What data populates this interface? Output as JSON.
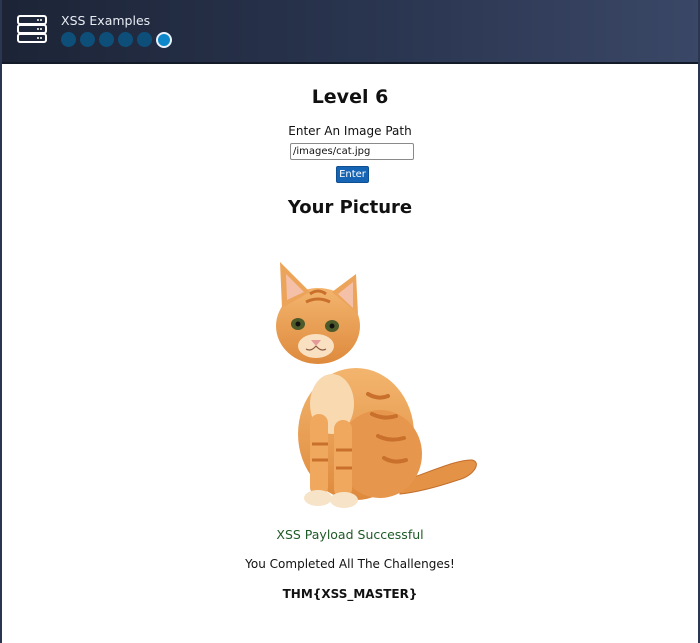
{
  "header": {
    "app_icon": "server-rack-icon",
    "title": "XSS Examples",
    "progress": {
      "total_levels": 6,
      "current_level": 6
    }
  },
  "main": {
    "level_title": "Level 6",
    "path_label": "Enter An Image Path",
    "path_input_value": "/images/cat.jpg",
    "enter_button_label": "Enter",
    "picture_heading": "Your Picture",
    "image_subject": "orange-kitten-image",
    "payload_status": "XSS Payload Successful",
    "completion_message": "You Completed All The Challenges!",
    "flag": "THM{XSS_MASTER}"
  },
  "colors": {
    "header_bg": "#2a3550",
    "progress_dot": "#0e4f7a",
    "progress_dot_current": "#0d87c9",
    "button_bg": "#1565b4",
    "success_text": "#1d5a26"
  }
}
